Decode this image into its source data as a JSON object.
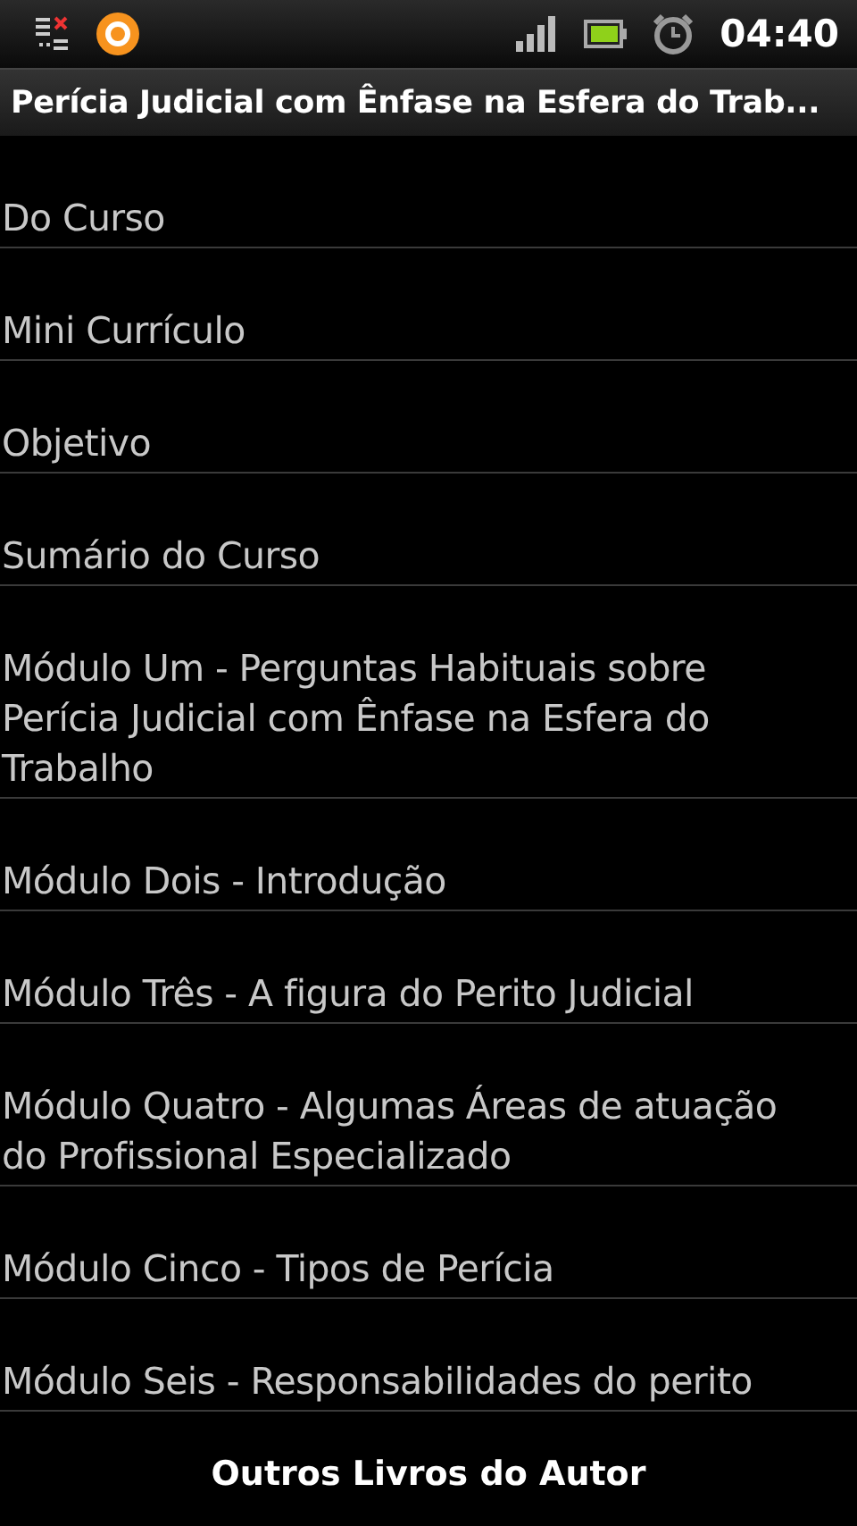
{
  "status_bar": {
    "time": "04:40"
  },
  "title": "Perícia Judicial com Ênfase na Esfera do Trab...",
  "items": [
    {
      "label": "Do Curso"
    },
    {
      "label": "Mini Currículo"
    },
    {
      "label": "Objetivo"
    },
    {
      "label": "Sumário do Curso"
    },
    {
      "label": "Módulo Um - Perguntas Habituais sobre Perícia Judicial com Ênfase na Esfera do Trabalho"
    },
    {
      "label": "Módulo Dois - Introdução"
    },
    {
      "label": "Módulo Três - A figura do Perito Judicial"
    },
    {
      "label": "Módulo Quatro - Algumas Áreas de atuação do Profissional Especializado"
    },
    {
      "label": "Módulo Cinco - Tipos de Perícia"
    },
    {
      "label": "Módulo Seis - Responsabilidades do perito"
    }
  ],
  "footer_button": "Outros Livros do Autor"
}
